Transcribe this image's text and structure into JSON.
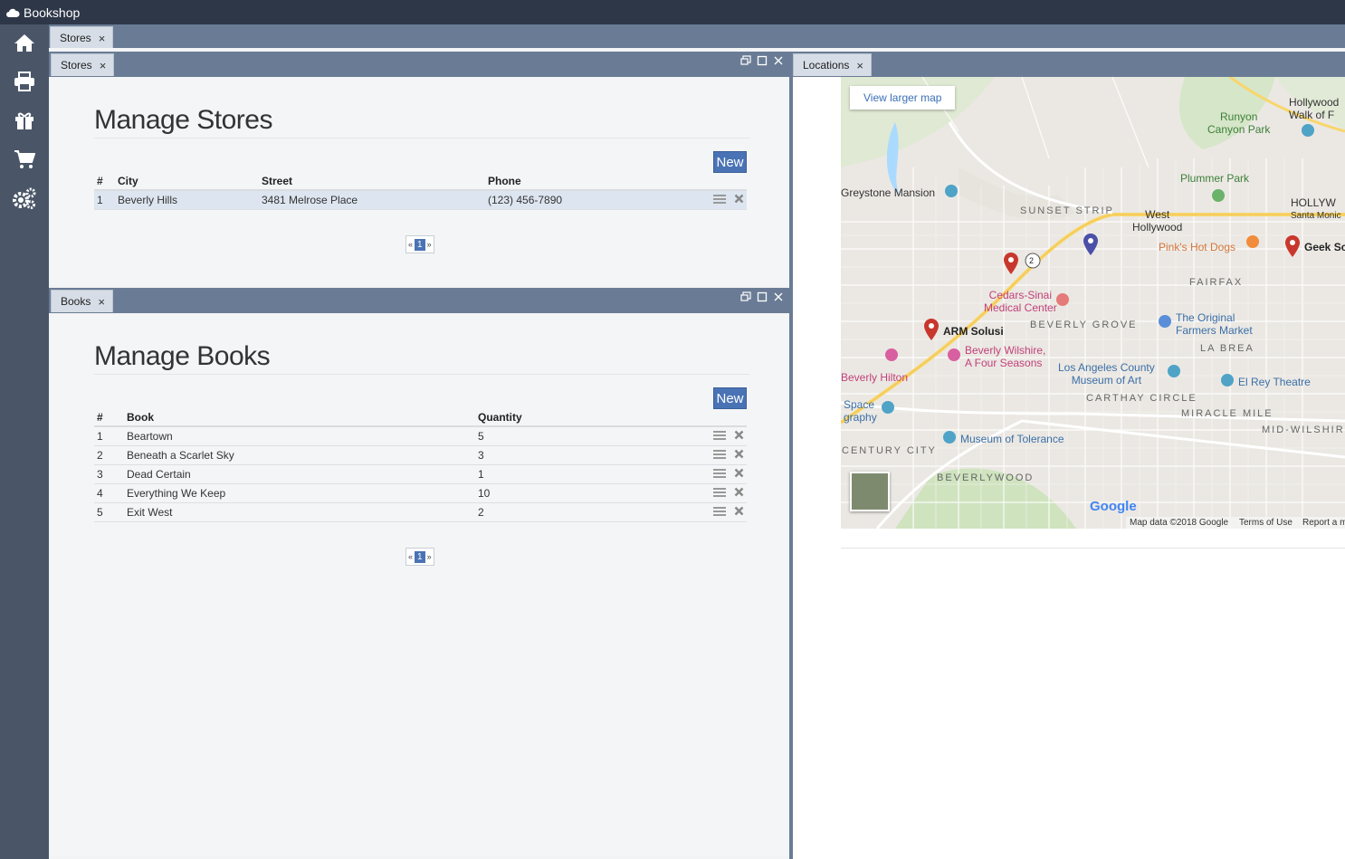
{
  "app": {
    "title": "Bookshop"
  },
  "sidebar": {
    "items": [
      {
        "name": "home-icon"
      },
      {
        "name": "print-icon"
      },
      {
        "name": "gift-icon"
      },
      {
        "name": "cart-icon"
      },
      {
        "name": "settings-gears-icon"
      }
    ]
  },
  "top_tab": {
    "label": "Stores",
    "close": "×"
  },
  "stores_panel": {
    "tab": "Stores",
    "close": "×",
    "heading": "Manage Stores",
    "new_label": "New",
    "columns": [
      "#",
      "City",
      "Street",
      "Phone"
    ],
    "rows": [
      {
        "num": "1",
        "city": "Beverly Hills",
        "street": "3481 Melrose Place",
        "phone": "(123) 456-7890"
      }
    ],
    "pager": {
      "prev": "«",
      "current": "1",
      "next": "»"
    }
  },
  "books_panel": {
    "tab": "Books",
    "close": "×",
    "heading": "Manage Books",
    "new_label": "New",
    "columns": [
      "#",
      "Book",
      "Quantity"
    ],
    "rows": [
      {
        "num": "1",
        "book": "Beartown",
        "qty": "5"
      },
      {
        "num": "2",
        "book": "Beneath a Scarlet Sky",
        "qty": "3"
      },
      {
        "num": "3",
        "book": "Dead Certain",
        "qty": "1"
      },
      {
        "num": "4",
        "book": "Everything We Keep",
        "qty": "10"
      },
      {
        "num": "5",
        "book": "Exit West",
        "qty": "2"
      }
    ],
    "pager": {
      "prev": "«",
      "current": "1",
      "next": "»"
    }
  },
  "locations_panel": {
    "tab": "Locations",
    "close": "×",
    "view_larger": "View larger map",
    "labels": {
      "runyon": "Runyon\nCanyon Park",
      "hollywood_walk": "Hollywood\nWalk of F",
      "plummer": "Plummer Park",
      "greystone": "Greystone Mansion",
      "sunset_strip": "SUNSET STRIP",
      "west_hollywood": "West\nHollywood",
      "pinks": "Pink's Hot Dogs",
      "geek": "Geek Sc",
      "fairfax": "FAIRFAX",
      "cedars": "Cedars-Sinai\nMedical Center",
      "beverly_grove": "BEVERLY GROVE",
      "farmers": "The Original\nFarmers Market",
      "arm": "ARM Solusi",
      "beverly_wilshire": "Beverly Wilshire,\nA Four Seasons",
      "la_brea": "LA BREA",
      "lacma": "Los Angeles County\nMuseum of Art",
      "el_rey": "El Rey Theatre",
      "hilton": "Beverly Hilton",
      "carthay": "CARTHAY CIRCLE",
      "miracle": "MIRACLE MILE",
      "space": "Space\ngraphy",
      "mid_wilshire": "MID-WILSHIR",
      "tolerance": "Museum of Tolerance",
      "century": "CENTURY CITY",
      "beverlywood": "BEVERLYWOOD",
      "hollyw": "HOLLYW",
      "santa_monica": "Santa Monic",
      "route": "2"
    },
    "footer": {
      "google": "Google",
      "mapdata": "Map data ©2018 Google",
      "terms": "Terms of Use",
      "report": "Report a m"
    },
    "colors": {
      "pin_red": "#c8372d",
      "pin_blue": "#4a4fa8"
    }
  }
}
